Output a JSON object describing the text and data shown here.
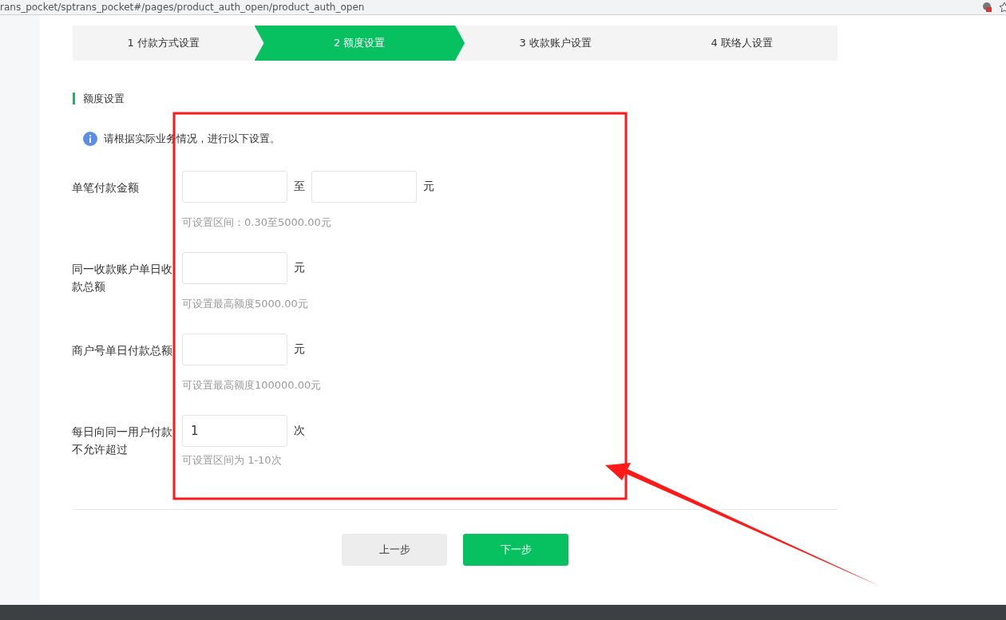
{
  "browser": {
    "url": "rans_pocket/sptrans_pocket#/pages/product_auth_open/product_auth_open"
  },
  "steps": [
    {
      "label": "1 付款方式设置",
      "selected": false
    },
    {
      "label": "2 额度设置",
      "selected": true
    },
    {
      "label": "3 收款账户设置",
      "selected": false
    },
    {
      "label": "4 联络人设置",
      "selected": false
    }
  ],
  "section_title": "额度设置",
  "notice": "请根据实际业务情况，进行以下设置。",
  "fields": [
    {
      "kind": "range",
      "label": "单笔付款金额",
      "separator": "至",
      "unit": "元",
      "hint": "可设置区间：0.30至5000.00元"
    },
    {
      "kind": "single",
      "label": "同一收款账户单日收款总额",
      "unit": "元",
      "hint": "可设置最高额度5000.00元"
    },
    {
      "kind": "single",
      "label": "商户号单日付款总额",
      "unit": "元",
      "hint": "可设置最高额度100000.00元"
    },
    {
      "kind": "single",
      "label": "每日向同一用户付款不允许超过",
      "value": "1",
      "unit": "次",
      "hint": "可设置区间为 1-10次"
    }
  ],
  "buttons": [
    {
      "label": "上一步",
      "kind": "secondary"
    },
    {
      "label": "下一步",
      "kind": "primary"
    }
  ]
}
